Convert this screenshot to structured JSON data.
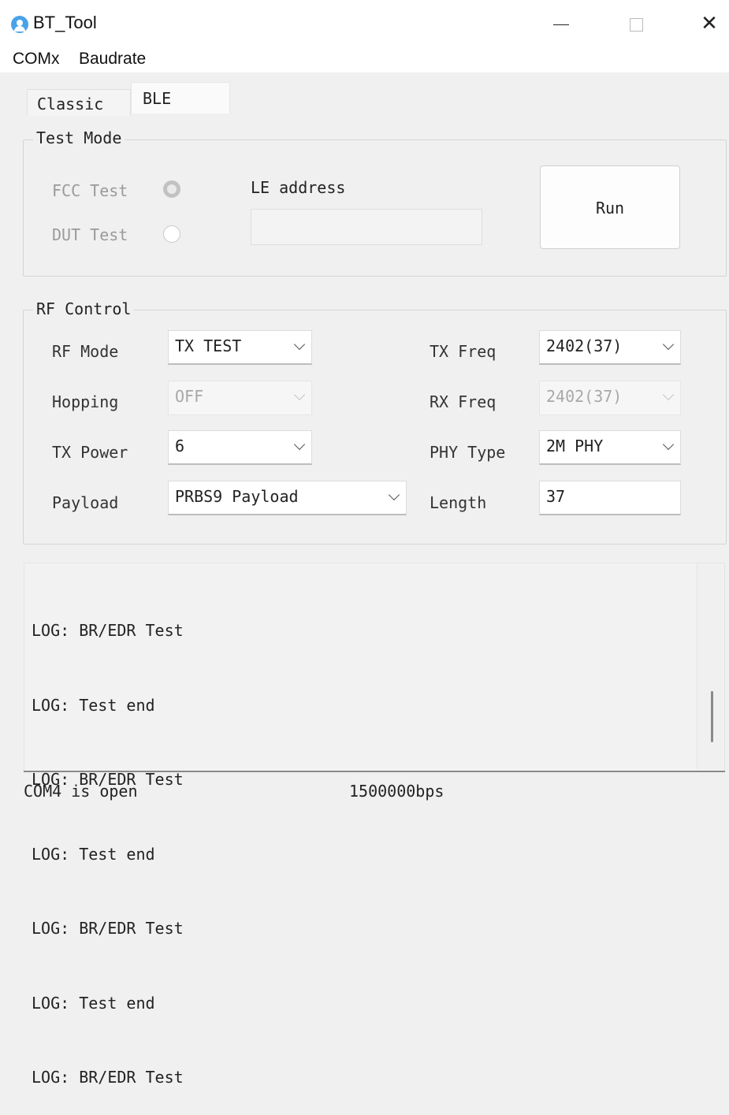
{
  "window": {
    "title": "BT_Tool"
  },
  "menu": {
    "items": [
      "COMx",
      "Baudrate"
    ]
  },
  "tabs": [
    {
      "label": "Classic"
    },
    {
      "label": "BLE",
      "selected": true
    }
  ],
  "test_mode": {
    "legend": "Test Mode",
    "fcc_label": "FCC Test",
    "dut_label": "DUT Test",
    "fcc_checked": true,
    "dut_checked": false,
    "le_address_label": "LE address",
    "le_address_value": "",
    "run_label": "Run"
  },
  "rf_control": {
    "legend": "RF Control",
    "rf_mode": {
      "label": "RF Mode",
      "value": "TX TEST"
    },
    "hopping": {
      "label": "Hopping",
      "value": "OFF"
    },
    "tx_power": {
      "label": "TX Power",
      "value": "6"
    },
    "payload": {
      "label": "Payload",
      "value": "PRBS9 Payload"
    },
    "tx_freq": {
      "label": "TX Freq",
      "value": "2402(37)"
    },
    "rx_freq": {
      "label": "RX Freq",
      "value": "2402(37)"
    },
    "phy_type": {
      "label": "PHY Type",
      "value": "2M PHY"
    },
    "length": {
      "label": "Length",
      "value": "37"
    }
  },
  "log": {
    "lines": [
      "LOG: BR/EDR Test",
      "LOG: Test end",
      "LOG: BR/EDR Test",
      "LOG: Test end",
      "LOG: BR/EDR Test",
      "LOG: Test end",
      "LOG: BR/EDR Test"
    ]
  },
  "status": {
    "port": "COM4 is open",
    "baudrate": "1500000bps"
  },
  "colors": {
    "icon_accent": "#4aa3e8",
    "background": "#f0f0f0"
  }
}
